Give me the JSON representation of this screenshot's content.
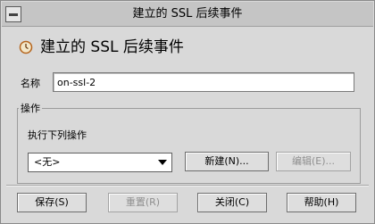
{
  "window": {
    "title": "建立的 SSL 后续事件"
  },
  "header": {
    "icon": "clock-icon",
    "title": "建立的 SSL 后续事件"
  },
  "form": {
    "name_label": "名称",
    "name_value": "on-ssl-2"
  },
  "operation": {
    "group_label": "操作",
    "run_label": "执行下列操作",
    "action_selected": "<无>",
    "new_button": "新建(N)...",
    "edit_button": "编辑(E)..."
  },
  "footer": {
    "save_button": "保存(S)",
    "reset_button": "重置(R)",
    "close_button": "关闭(C)",
    "help_button": "帮助(H)"
  }
}
